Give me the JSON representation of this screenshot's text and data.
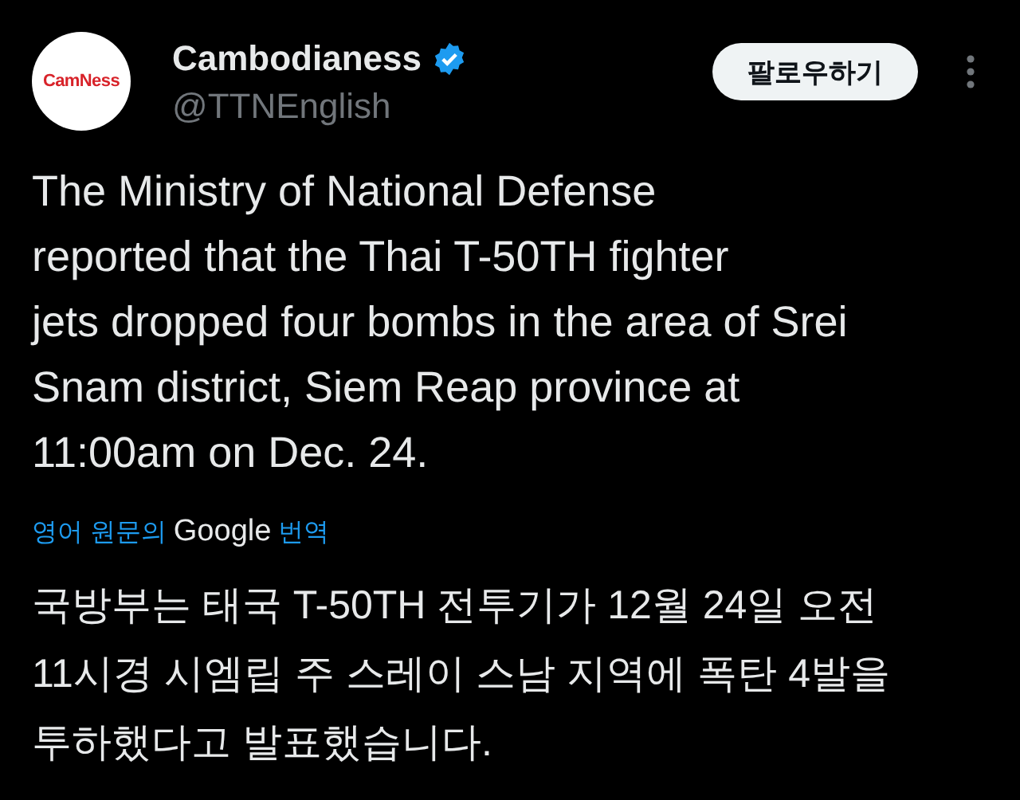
{
  "author": {
    "name": "Cambodianess",
    "verified": true,
    "handle": "@TTNEnglish",
    "logo_text": "CamNess"
  },
  "follow_button": "팔로우하기",
  "post_text": "The Ministry of National Defense\nreported that the Thai T-50TH fighter\njets dropped four bombs in the area of Srei\nSnam district, Siem Reap province at\n11:00am on Dec. 24.",
  "translation": {
    "prefix": "영어 원문의",
    "provider": "Google",
    "suffix": "번역"
  },
  "translated_text": "국방부는 태국 T-50TH 전투기가 12월 24일 오전\n11시경 시엠립 주 스레이 스남 지역에 폭탄 4발을\n투하했다고 발표했습니다."
}
